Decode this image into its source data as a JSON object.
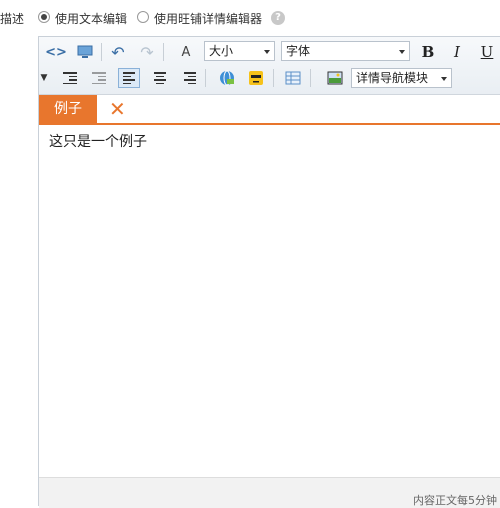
{
  "header": {
    "label": "编辑描述",
    "option_text": "使用文本编辑",
    "option_wangpu": "使用旺铺详情编辑器",
    "help": "?"
  },
  "toolbar": {
    "font_size": "大小",
    "font_family": "字体",
    "bold": "B",
    "italic": "I",
    "underline": "U",
    "detail_nav": "详情导航模块"
  },
  "tabs": [
    {
      "label": "例子"
    }
  ],
  "content": {
    "text": "这只是一个例子"
  },
  "status": {
    "text": "内容正文每5分钟"
  }
}
